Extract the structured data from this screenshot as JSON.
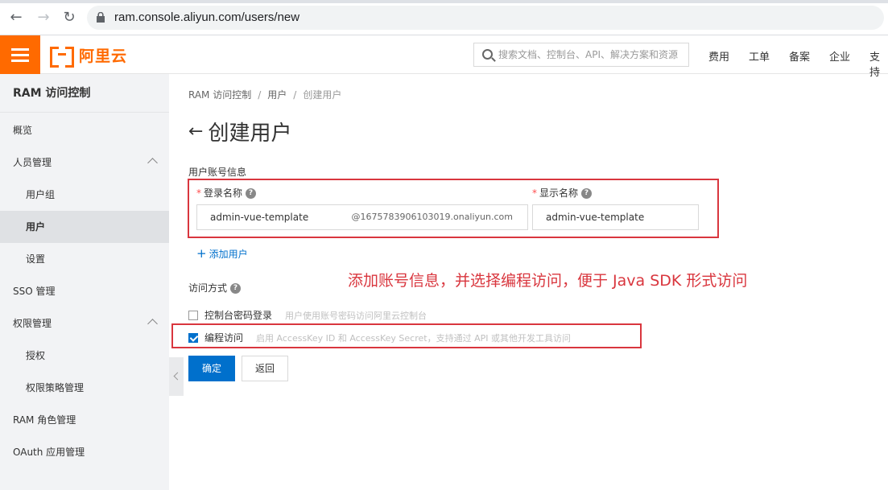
{
  "browser": {
    "url": "ram.console.aliyun.com/users/new"
  },
  "topnav": {
    "brand": "阿里云",
    "search_placeholder": "搜索文档、控制台、API、解决方案和资源",
    "links": [
      "费用",
      "工单",
      "备案",
      "企业",
      "支持"
    ]
  },
  "sidebar": {
    "title": "RAM 访问控制",
    "items": [
      {
        "label": "概览"
      },
      {
        "label": "人员管理"
      },
      {
        "label": "用户组"
      },
      {
        "label": "用户"
      },
      {
        "label": "设置"
      },
      {
        "label": "SSO 管理"
      },
      {
        "label": "权限管理"
      },
      {
        "label": "授权"
      },
      {
        "label": "权限策略管理"
      },
      {
        "label": "RAM 角色管理"
      },
      {
        "label": "OAuth 应用管理"
      }
    ]
  },
  "breadcrumb": [
    "RAM 访问控制",
    "用户",
    "创建用户"
  ],
  "page_title": "创建用户",
  "form": {
    "section_title": "用户账号信息",
    "login_name_label": "登录名称",
    "login_name_value": "admin-vue-template",
    "login_name_suffix": "@1675783906103019.onaliyun.com",
    "display_name_label": "显示名称",
    "display_name_value": "admin-vue-template",
    "add_user": "添加用户",
    "access_mode_label": "访问方式",
    "console_login_label": "控制台密码登录",
    "console_login_desc": "用户使用账号密码访问阿里云控制台",
    "console_login_checked": false,
    "programmatic_label": "编程访问",
    "programmatic_desc": "启用 AccessKey ID 和 AccessKey Secret，支持通过 API 或其他开发工具访问",
    "programmatic_checked": true,
    "confirm_label": "确定",
    "back_label": "返回",
    "help_glyph": "?"
  },
  "annotation": "添加账号信息，并选择编程访问，便于 Java SDK 形式访问",
  "colors": {
    "brand_orange": "#ff6a00",
    "primary_blue": "#0070cc",
    "annotation_red": "#d9363e"
  }
}
